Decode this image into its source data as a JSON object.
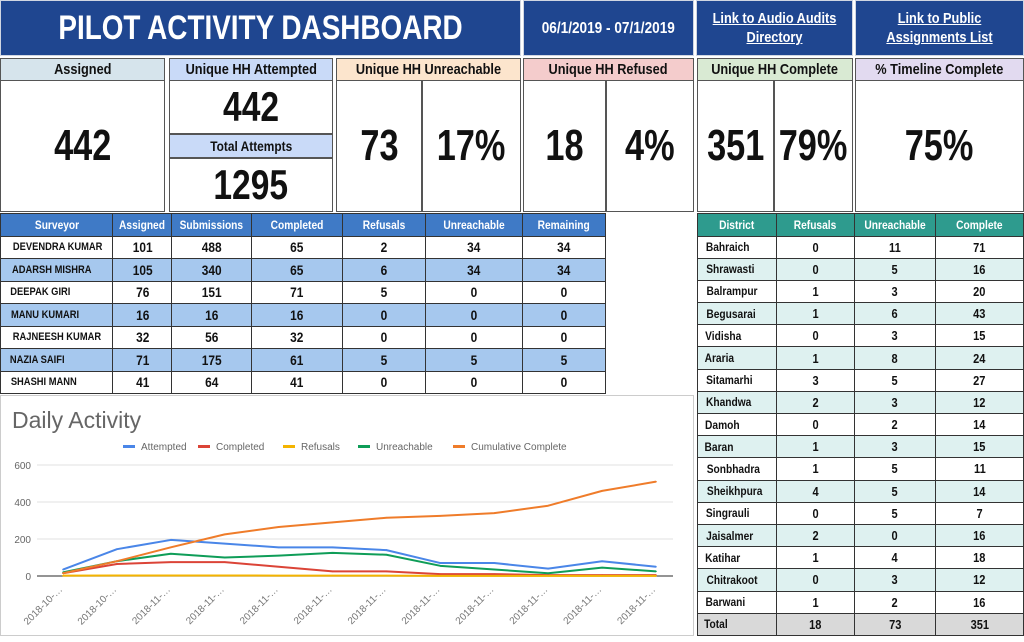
{
  "header": {
    "title": "PILOT ACTIVITY DASHBOARD",
    "date_range": "06/1/2019 - 07/1/2019",
    "link_audio": "Link to Audio Audits Directory",
    "link_assignments": "Link to Public Assignments List"
  },
  "kpis": {
    "assigned": {
      "label": "Assigned",
      "value": "442"
    },
    "attempted": {
      "label": "Unique HH Attempted",
      "value": "442",
      "sub_label": "Total Attempts",
      "sub_value": "1295"
    },
    "unreachable": {
      "label": "Unique HH Unreachable",
      "value": "73",
      "pct": "17%"
    },
    "refused": {
      "label": "Unique HH Refused",
      "value": "18",
      "pct": "4%"
    },
    "complete": {
      "label": "Unique HH Complete",
      "value": "351",
      "pct": "79%"
    },
    "timeline": {
      "label": "% Timeline Complete",
      "value": "75%"
    }
  },
  "colors": {
    "navy": "#1f4690",
    "assigned_hdr": "#d6e4ec",
    "attempted_hdr": "#c9daf8",
    "unreachable_hdr": "#fce5cd",
    "refused_hdr": "#f4cccc",
    "complete_hdr": "#d9ead3",
    "timeline_hdr": "#e2daf0"
  },
  "surveyors": {
    "columns": [
      "Surveyor",
      "Assigned",
      "Submissions",
      "Completed",
      "Refusals",
      "Unreachable",
      "Remaining"
    ],
    "rows": [
      [
        "DEVENDRA KUMAR",
        "101",
        "488",
        "65",
        "2",
        "34",
        "34"
      ],
      [
        "ADARSH MISHRA",
        "105",
        "340",
        "65",
        "6",
        "34",
        "34"
      ],
      [
        "DEEPAK GIRI",
        "76",
        "151",
        "71",
        "5",
        "0",
        "0"
      ],
      [
        "MANU KUMARI",
        "16",
        "16",
        "16",
        "0",
        "0",
        "0"
      ],
      [
        "RAJNEESH KUMAR",
        "32",
        "56",
        "32",
        "0",
        "0",
        "0"
      ],
      [
        "NAZIA SAIFI",
        "71",
        "175",
        "61",
        "5",
        "5",
        "5"
      ],
      [
        "SHASHI MANN",
        "41",
        "64",
        "41",
        "0",
        "0",
        "0"
      ]
    ]
  },
  "districts": {
    "columns": [
      "District",
      "Refusals",
      "Unreachable",
      "Complete"
    ],
    "rows": [
      [
        "Bahraich",
        "0",
        "11",
        "71"
      ],
      [
        "Shrawasti",
        "0",
        "5",
        "16"
      ],
      [
        "Balrampur",
        "1",
        "3",
        "20"
      ],
      [
        "Begusarai",
        "1",
        "6",
        "43"
      ],
      [
        "Vidisha",
        "0",
        "3",
        "15"
      ],
      [
        "Araria",
        "1",
        "8",
        "24"
      ],
      [
        "Sitamarhi",
        "3",
        "5",
        "27"
      ],
      [
        "Khandwa",
        "2",
        "3",
        "12"
      ],
      [
        "Damoh",
        "0",
        "2",
        "14"
      ],
      [
        "Baran",
        "1",
        "3",
        "15"
      ],
      [
        "Sonbhadra",
        "1",
        "5",
        "11"
      ],
      [
        "Sheikhpura",
        "4",
        "5",
        "14"
      ],
      [
        "Singrauli",
        "0",
        "5",
        "7"
      ],
      [
        "Jaisalmer",
        "2",
        "0",
        "16"
      ],
      [
        "Katihar",
        "1",
        "4",
        "18"
      ],
      [
        "Chitrakoot",
        "0",
        "3",
        "12"
      ],
      [
        "Barwani",
        "1",
        "2",
        "16"
      ]
    ],
    "total": [
      "Total",
      "18",
      "73",
      "351"
    ]
  },
  "chart_data": {
    "type": "line",
    "title": "Daily Activity",
    "xlabel": "",
    "ylabel": "",
    "ylim": [
      0,
      600
    ],
    "yticks": [
      "0",
      "200",
      "400",
      "600"
    ],
    "grid": true,
    "legend": "top",
    "x": [
      "2018-10-…",
      "2018-10-…",
      "2018-11-…",
      "2018-11-…",
      "2018-11-…",
      "2018-11-…",
      "2018-11-…",
      "2018-11-…",
      "2018-11-…",
      "2018-11-…",
      "2018-11-…",
      "2018-11-…"
    ],
    "series": [
      {
        "name": "Attempted",
        "color": "#4a86e8",
        "values": [
          35,
          145,
          195,
          175,
          155,
          155,
          140,
          70,
          70,
          40,
          80,
          50
        ]
      },
      {
        "name": "Completed",
        "color": "#db4437",
        "values": [
          15,
          65,
          75,
          75,
          50,
          25,
          25,
          10,
          10,
          5,
          5,
          5
        ]
      },
      {
        "name": "Refusals",
        "color": "#f4b400",
        "values": [
          2,
          3,
          3,
          3,
          2,
          2,
          2,
          1,
          1,
          1,
          1,
          1
        ]
      },
      {
        "name": "Unreachable",
        "color": "#0f9d58",
        "values": [
          20,
          80,
          120,
          100,
          110,
          125,
          115,
          55,
          35,
          15,
          45,
          25
        ]
      },
      {
        "name": "Cumulative Complete",
        "color": "#ef7c2a",
        "values": [
          15,
          80,
          155,
          225,
          265,
          290,
          315,
          325,
          340,
          380,
          460,
          510
        ]
      }
    ]
  }
}
